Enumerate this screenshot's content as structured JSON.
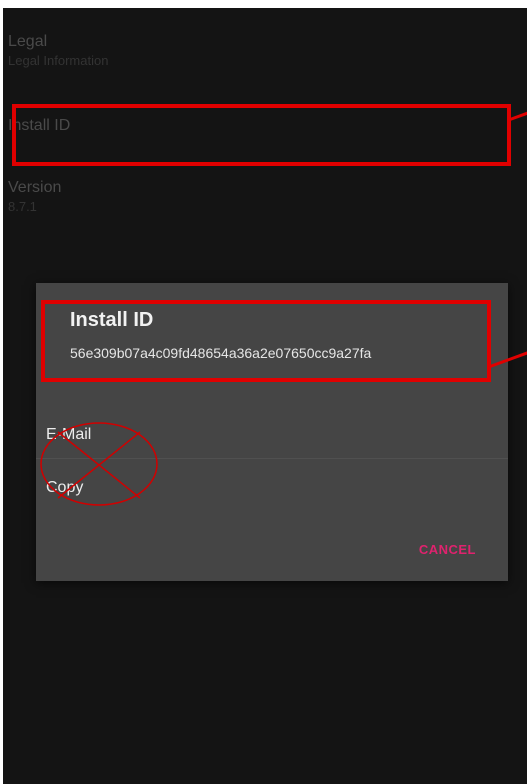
{
  "settings": {
    "legal_title": "Legal",
    "legal_summary": "Legal Information",
    "install_id_title": "Install ID",
    "version_title": "Version",
    "version_value": "8.7.1"
  },
  "dialog": {
    "title": "Install ID",
    "message": "56e309b07a4c09fd48654a36a2e07650cc9a27fa",
    "options": [
      "E-Mail",
      "Copy"
    ],
    "cancel_label": "CANCEL"
  },
  "colors": {
    "highlight": "#e00000",
    "accent": "#e0226e"
  }
}
